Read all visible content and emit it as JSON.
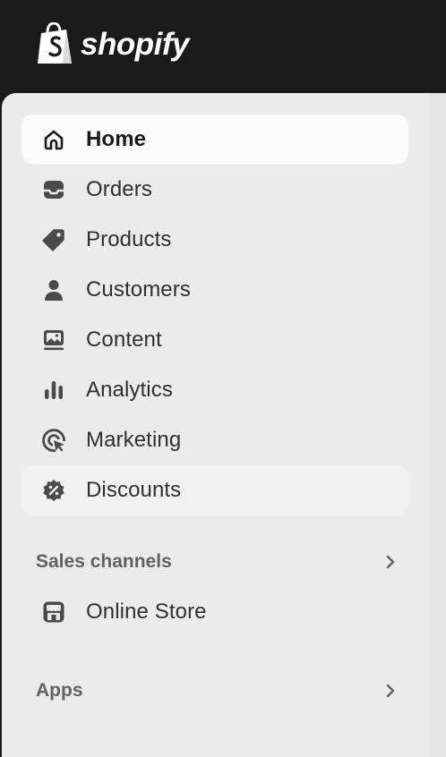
{
  "brand": {
    "logo_text": "shopify"
  },
  "nav": {
    "items": [
      {
        "label": "Home",
        "icon": "home-icon"
      },
      {
        "label": "Orders",
        "icon": "inbox-icon"
      },
      {
        "label": "Products",
        "icon": "tag-icon"
      },
      {
        "label": "Customers",
        "icon": "person-icon"
      },
      {
        "label": "Content",
        "icon": "image-content-icon"
      },
      {
        "label": "Analytics",
        "icon": "bar-chart-icon"
      },
      {
        "label": "Marketing",
        "icon": "target-icon"
      },
      {
        "label": "Discounts",
        "icon": "discount-icon"
      }
    ]
  },
  "sales_channels": {
    "label": "Sales channels",
    "items": [
      {
        "label": "Online Store",
        "icon": "store-icon"
      }
    ]
  },
  "apps": {
    "label": "Apps"
  },
  "colors": {
    "topbar": "#1a1a1a",
    "sidebar_bg": "#ebebeb",
    "active_item_bg": "#fafafa",
    "text_primary": "#303030",
    "text_secondary": "#616161"
  }
}
